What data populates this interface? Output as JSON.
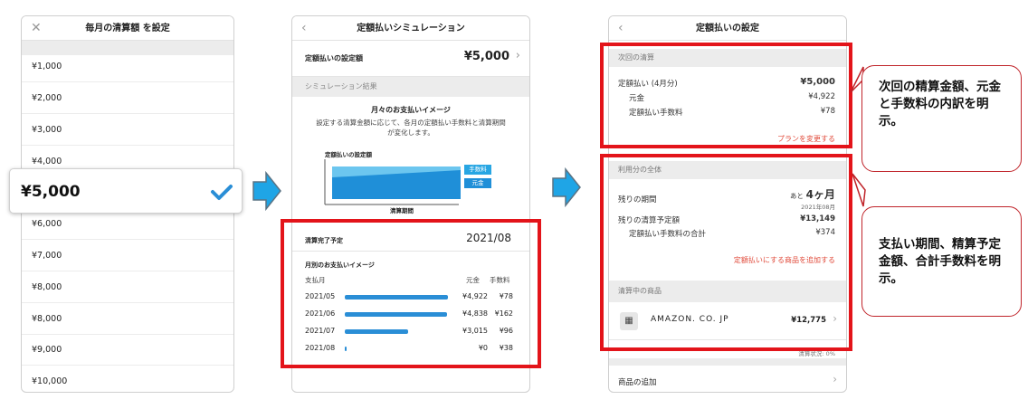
{
  "screen1": {
    "title": "毎月の清算額 を設定",
    "close_icon": "close-icon",
    "options": [
      "¥1,000",
      "¥2,000",
      "¥3,000",
      "¥4,000",
      "¥6,000",
      "¥7,000",
      "¥8,000",
      "¥8,000",
      "¥9,000",
      "¥10,000"
    ],
    "selected": "¥5,000"
  },
  "screen2": {
    "title": "定額払いシミュレーション",
    "setting_label": "定額払いの設定額",
    "setting_value": "¥5,000",
    "section_result": "シミュレーション結果",
    "monthly_heading": "月々のお支払いイメージ",
    "description": "設定する清算金額に応じて、各月の定額払い手数料と清算期間が変化します。",
    "chart_title": "定額払いの設定額",
    "chart_legend_fee": "手数料",
    "chart_legend_principal": "元金",
    "chart_xlabel": "清算期間",
    "complete_label": "清算完了予定",
    "complete_value": "2021/08",
    "monthly_table_title": "月別のお支払いイメージ",
    "col_month": "支払月",
    "col_principal": "元金",
    "col_fee": "手数料",
    "rows": [
      {
        "month": "2021/05",
        "principal": "¥4,922",
        "fee": "¥78",
        "fill": 0.98
      },
      {
        "month": "2021/06",
        "principal": "¥4,838",
        "fee": "¥162",
        "fill": 0.97
      },
      {
        "month": "2021/07",
        "principal": "¥3,015",
        "fee": "¥96",
        "fill": 0.6
      },
      {
        "month": "2021/08",
        "principal": "¥0",
        "fee": "¥38",
        "fill": 0.01
      }
    ]
  },
  "screen3": {
    "title": "定額払いの設定",
    "next_section": "次回の清算",
    "next_label": "定額払い (4月分)",
    "next_value": "¥5,000",
    "principal_label": "元金",
    "principal_value": "¥4,922",
    "fee_label": "定額払い手数料",
    "fee_value": "¥78",
    "change_plan": "プランを変更する",
    "usage_section": "利用分の全体",
    "remaining_label": "残りの期間",
    "remaining_prefix": "あと",
    "remaining_value": "4ヶ月",
    "remaining_date": "2021年08月",
    "remaining_amount_label": "残りの清算予定額",
    "remaining_amount_value": "¥13,149",
    "total_fee_label": "定額払い手数料の合計",
    "total_fee_value": "¥374",
    "add_item_link": "定額払いにする商品を追加する",
    "items_section": "清算中の商品",
    "item_name": "AMAZON. CO. JP",
    "item_value": "¥12,775",
    "progress_text": "清算状況: 0%",
    "add_goods": "商品の追加"
  },
  "callouts": {
    "top": "次回の精算金額、元金と手数料の内訳を明示。",
    "bottom": "支払い期間、精算予定金額、合計手数料を明示。"
  },
  "colors": {
    "accent_blue": "#2a8ed6",
    "highlight_red": "#e3141a",
    "link_red": "#e14c3c",
    "arrow_blue": "#1fa5e6"
  }
}
